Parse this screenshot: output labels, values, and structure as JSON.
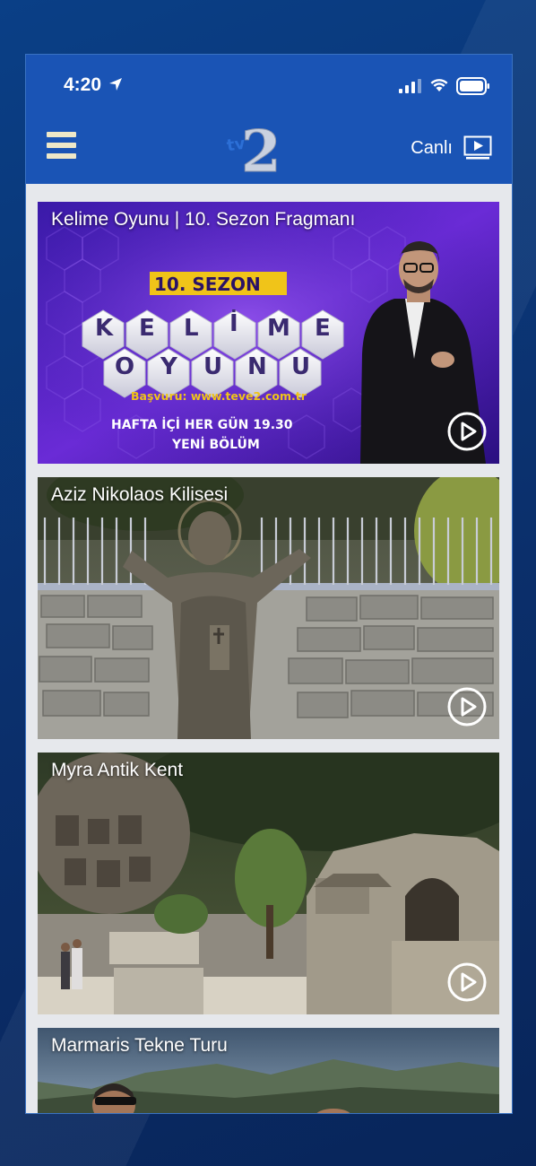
{
  "status": {
    "time": "4:20"
  },
  "header": {
    "logo_alt": "teve2",
    "live_label": "Canlı"
  },
  "colors": {
    "header_blue": "#1a54b5",
    "background": "#e6e8ec",
    "accent_yellow": "#f0c419"
  },
  "cards": [
    {
      "title": "Kelime Oyunu | 10. Sezon Fragmanı",
      "promo": {
        "season": "10. SEZON",
        "word1": [
          "K",
          "E",
          "L",
          "İ",
          "M",
          "E"
        ],
        "word2": [
          "O",
          "Y",
          "U",
          "N",
          "U"
        ],
        "apply": "Başvuru: www.teve2.com.tr",
        "schedule": "HAFTA İÇİ HER GÜN 19.30",
        "new_episode": "YENİ BÖLÜM"
      }
    },
    {
      "title": "Aziz Nikolaos Kilisesi"
    },
    {
      "title": "Myra Antik Kent"
    },
    {
      "title": "Marmaris Tekne Turu"
    }
  ]
}
